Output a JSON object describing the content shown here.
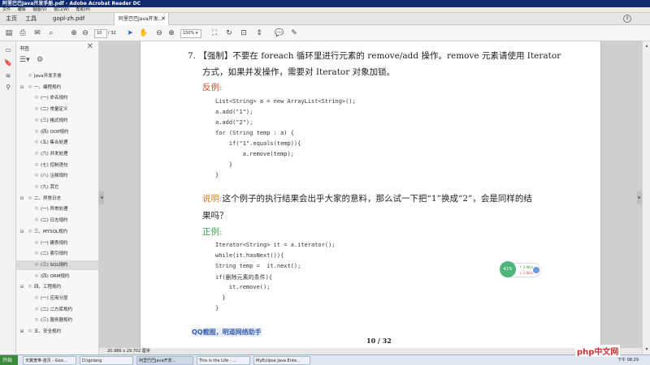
{
  "window": {
    "title": "阿里巴巴Java开发手册.pdf - Adobe Acrobat Reader DC"
  },
  "menu": [
    "文件",
    "编辑",
    "视图(V)",
    "窗口(W)",
    "帮助(H)"
  ],
  "tabs": {
    "home": "主页",
    "tools": "工具",
    "doc1": "gopl-zh.pdf",
    "doc2": "阿里巴巴Java开发..."
  },
  "toolbar": {
    "page_current": "10",
    "page_total": "/ 32",
    "zoom": "150%"
  },
  "panel": {
    "title": "书签"
  },
  "bookmarks": [
    {
      "label": "Java开发手册",
      "level": 0,
      "expand": "",
      "selected": false
    },
    {
      "label": "一、编程规约",
      "level": 0,
      "expand": "⊟",
      "selected": false
    },
    {
      "label": "(一) 命名规约",
      "level": 1,
      "expand": "",
      "selected": false
    },
    {
      "label": "(二) 常量定义",
      "level": 1,
      "expand": "",
      "selected": false
    },
    {
      "label": "(三) 格式规约",
      "level": 1,
      "expand": "",
      "selected": false
    },
    {
      "label": "(四) OOP规约",
      "level": 1,
      "expand": "",
      "selected": false
    },
    {
      "label": "(五) 集合处理",
      "level": 1,
      "expand": "",
      "selected": false
    },
    {
      "label": "(六) 并发处理",
      "level": 1,
      "expand": "",
      "selected": false
    },
    {
      "label": "(七) 控制语句",
      "level": 1,
      "expand": "",
      "selected": false
    },
    {
      "label": "(八) 注释规约",
      "level": 1,
      "expand": "",
      "selected": false
    },
    {
      "label": "(九) 其它",
      "level": 1,
      "expand": "",
      "selected": false
    },
    {
      "label": "二、异常日志",
      "level": 0,
      "expand": "⊟",
      "selected": false
    },
    {
      "label": "(一) 异常处理",
      "level": 1,
      "expand": "",
      "selected": false
    },
    {
      "label": "(二) 日志规约",
      "level": 1,
      "expand": "",
      "selected": false
    },
    {
      "label": "三、MYSQL规约",
      "level": 0,
      "expand": "⊟",
      "selected": false
    },
    {
      "label": "(一) 建表规约",
      "level": 1,
      "expand": "",
      "selected": false
    },
    {
      "label": "(二) 索引规约",
      "level": 1,
      "expand": "",
      "selected": false
    },
    {
      "label": "(三) SQL规约",
      "level": 1,
      "expand": "",
      "selected": true
    },
    {
      "label": "(四) ORM规约",
      "level": 1,
      "expand": "",
      "selected": false
    },
    {
      "label": "四、工程规约",
      "level": 0,
      "expand": "⊟",
      "selected": false
    },
    {
      "label": "(一) 应用分层",
      "level": 1,
      "expand": "",
      "selected": false
    },
    {
      "label": "(二) 二方库规约",
      "level": 1,
      "expand": "",
      "selected": false
    },
    {
      "label": "(三) 服务器规约",
      "level": 1,
      "expand": "",
      "selected": false
    },
    {
      "label": "五、安全规约",
      "level": 0,
      "expand": "⊞",
      "selected": false
    }
  ],
  "content": {
    "item_num": "7.",
    "rule_tag": "【强制】",
    "rule_line1": "不要在 foreach 循环里进行元素的 remove/add 操作。remove 元素请使用 Iterator",
    "rule_line2": "方式，如果并发操作，需要对 Iterator 对象加锁。",
    "counter_label": "反例:",
    "counter_code": [
      "List<String> a = new ArrayList<String>();",
      "a.add(\"1\");",
      "a.add(\"2\");",
      "for (String temp : a) {",
      "    if(\"1\".equals(temp)){",
      "        a.remove(temp);",
      "    }",
      "}"
    ],
    "note_label": "说明:",
    "note_line1": "这个例子的执行结果会出乎大家的意料，那么试一下把“1”换成“2”，会是同样的结",
    "note_line2": "果吗？",
    "positive_label": "正例:",
    "positive_code": [
      "Iterator<String> it = a.iterator();",
      "while(it.hasNext()){",
      "String temp =  it.next();",
      "if(删除元素的条件){",
      "    it.remove();",
      "  }",
      "}"
    ],
    "page_number": "10 / 32"
  },
  "status": {
    "page_size": "20.986 x 29.702 厘米"
  },
  "net_widget": {
    "percent": "41%",
    "up": "2.9K/s",
    "down": "2.6K/s"
  },
  "watermark": "QQ截图，明道网络助手",
  "taskbar": {
    "start": "开始",
    "items": [
      "天翼宽带-首页 - Goo...",
      "D:\\golang",
      "阿里巴巴Java开发...",
      "This is the Life - ...",
      "MyEclipse Java Ente..."
    ],
    "clock": "下午 08:29"
  },
  "brand": "php中文网"
}
